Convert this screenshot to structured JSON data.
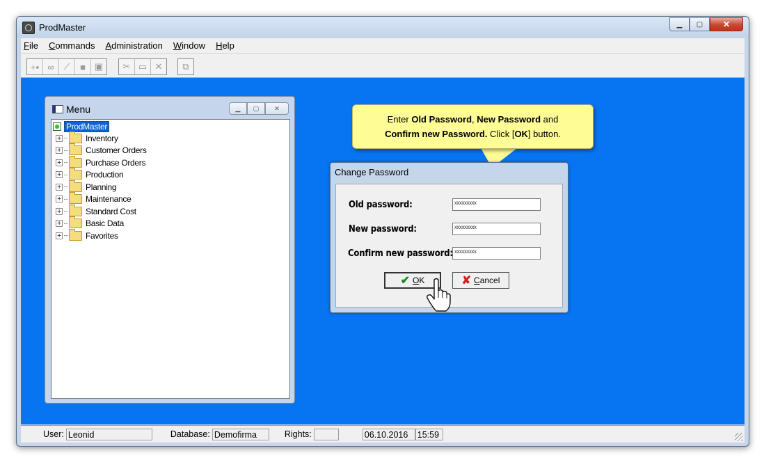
{
  "app": {
    "title": "ProdMaster",
    "icon": "gear-icon"
  },
  "menubar": [
    {
      "key": "F",
      "rest": "ile"
    },
    {
      "key": "C",
      "rest": "ommands"
    },
    {
      "key": "A",
      "rest": "dministration"
    },
    {
      "key": "W",
      "rest": "indow"
    },
    {
      "key": "H",
      "rest": "elp"
    }
  ],
  "toolbar": {
    "group1": [
      "new-record-icon",
      "find-icon",
      "edit-icon",
      "save-icon",
      "copy-icon"
    ],
    "group2": [
      "cut-icon",
      "open-folder-icon",
      "delete-icon"
    ],
    "group3": [
      "print-icon"
    ]
  },
  "menu_window": {
    "title": "Menu",
    "root": "ProdMaster",
    "items": [
      "Inventory",
      "Customer Orders",
      "Purchase Orders",
      "Production",
      "Planning",
      "Maintenance",
      "Standard Cost",
      "Basic Data",
      "Favorites"
    ]
  },
  "callout": {
    "line1_pre": "Enter ",
    "line1_b1": "Old Password",
    "line1_mid": ", ",
    "line1_b2": "New Password",
    "line1_post": " and",
    "line2_b1": "Confirm new Password.",
    "line2_mid": " Click [",
    "line2_b2": "OK",
    "line2_post": "] button."
  },
  "dialog": {
    "title": "Change Password",
    "old_label": "Old password:",
    "old_value": "xxxxxxxxx",
    "new_label": "New password:",
    "new_value": "xxxxxxxxx",
    "confirm_label": "Confirm new password:",
    "confirm_value": "xxxxxxxxx",
    "ok_key": "O",
    "ok_rest": "K",
    "cancel_key": "C",
    "cancel_rest": "ancel"
  },
  "status": {
    "user_label": "User:",
    "user": "Leonid",
    "db_label": "Database:",
    "db": "Demofirma",
    "rights_label": "Rights:",
    "rights": "",
    "date": "06.10.2016",
    "time": "15:59"
  }
}
